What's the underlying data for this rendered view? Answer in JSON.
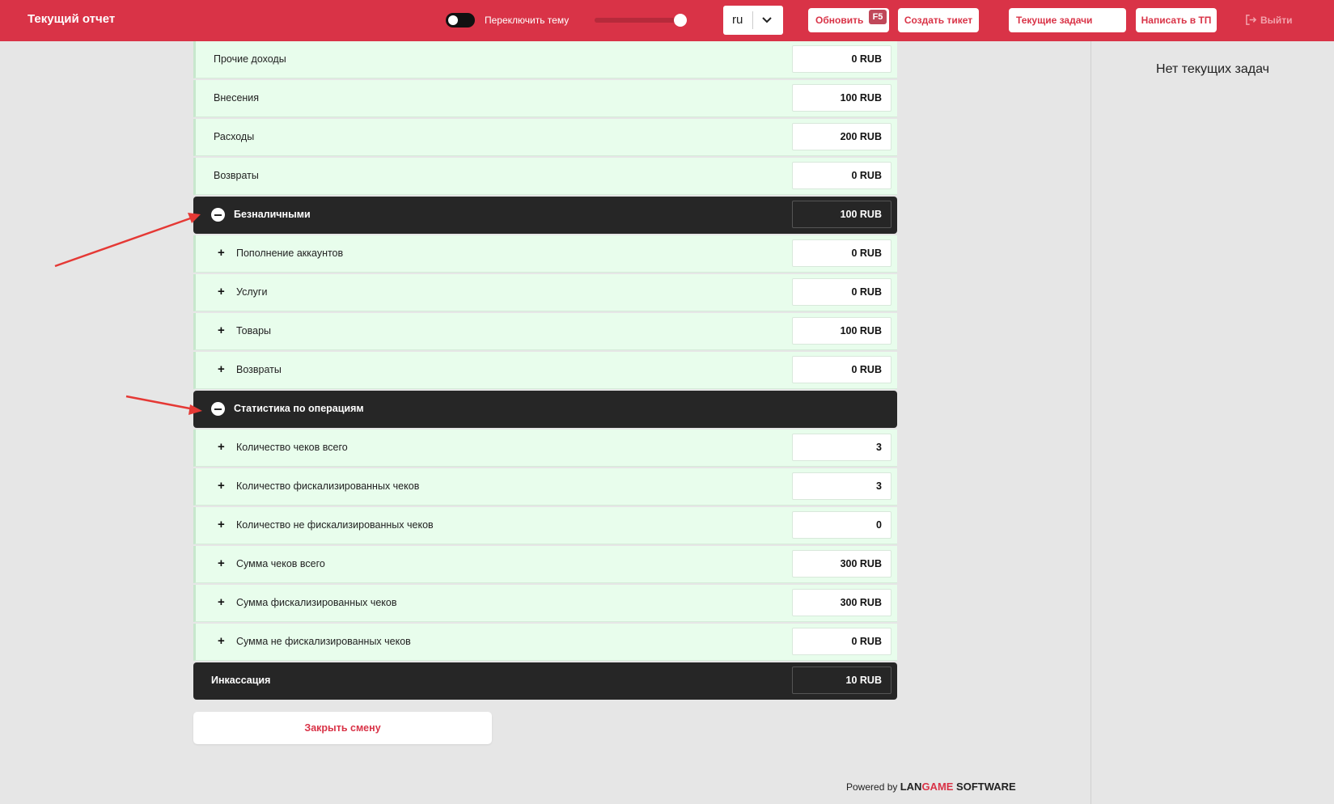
{
  "header": {
    "title": "Текущий отчет",
    "theme_toggle_label": "Переключить тему",
    "theme_toggle_on": false,
    "slider_level": 0.96,
    "language": "ru",
    "refresh_label": "Обновить",
    "refresh_hotkey": "F5",
    "create_ticket_label": "Создать тикет",
    "current_tasks_label": "Текущие задачи",
    "support_label": "Написать в ТП",
    "logout_label": "Выйти"
  },
  "right_panel": {
    "empty_text": "Нет текущих задач"
  },
  "report": {
    "rows": [
      {
        "label": "Прочие доходы",
        "value": "0 RUB",
        "kind": "plain"
      },
      {
        "label": "Внесения",
        "value": "100 RUB",
        "kind": "plain"
      },
      {
        "label": "Расходы",
        "value": "200 RUB",
        "kind": "plain"
      },
      {
        "label": "Возвраты",
        "value": "0 RUB",
        "kind": "plain"
      },
      {
        "label": "Безналичными",
        "value": "100 RUB",
        "kind": "section"
      },
      {
        "label": "Пополнение аккаунтов",
        "value": "0 RUB",
        "kind": "sub"
      },
      {
        "label": "Услуги",
        "value": "0 RUB",
        "kind": "sub"
      },
      {
        "label": "Товары",
        "value": "100 RUB",
        "kind": "sub"
      },
      {
        "label": "Возвраты",
        "value": "0 RUB",
        "kind": "sub"
      },
      {
        "label": "Статистика по операциям",
        "value": "",
        "kind": "section"
      },
      {
        "label": "Количество чеков всего",
        "value": "3",
        "kind": "sub"
      },
      {
        "label": "Количество фискализированных чеков",
        "value": "3",
        "kind": "sub"
      },
      {
        "label": "Количество не фискализированных чеков",
        "value": "0",
        "kind": "sub"
      },
      {
        "label": "Сумма чеков всего",
        "value": "300 RUB",
        "kind": "sub"
      },
      {
        "label": "Сумма фискализированных чеков",
        "value": "300 RUB",
        "kind": "sub"
      },
      {
        "label": "Сумма не фискализированных чеков",
        "value": "0 RUB",
        "kind": "sub"
      },
      {
        "label": "Инкассация",
        "value": "10 RUB",
        "kind": "total"
      }
    ],
    "close_shift_label": "Закрыть смену"
  },
  "footer": {
    "powered_by": "Powered by",
    "brand_lan": "LAN",
    "brand_game": "GAME",
    "brand_software": " SOFTWARE"
  },
  "colors": {
    "accent": "#d93347",
    "row_bg": "#e8fdec",
    "section_bg": "#262626",
    "annotation_arrow": "#e53935"
  }
}
